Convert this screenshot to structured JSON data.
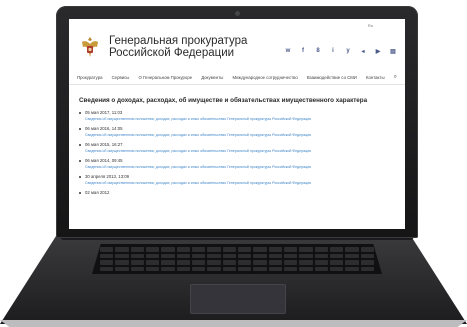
{
  "site": {
    "title_line1": "Генеральная прокуратура",
    "title_line2": "Российской Федерации",
    "topbar": [
      "Ru",
      "",
      "",
      ""
    ],
    "social": [
      "vk-icon",
      "facebook-icon",
      "odnoklassniki-icon",
      "instagram-icon",
      "twitter-icon",
      "telegram-icon",
      "youtube-icon",
      "rss-icon"
    ],
    "social_glyphs": [
      "w",
      "f",
      "8",
      "i",
      "y",
      "◂",
      "▶",
      "▤"
    ]
  },
  "nav": {
    "items": [
      "Прокуратура",
      "Cервисы",
      "О Генеральном Прокуроре",
      "Документы",
      "Международное сотрудничество",
      "Взаимодействие со СМИ",
      "Контакты"
    ],
    "search_glyph": "⌕"
  },
  "content": {
    "heading": "Сведения о доходах, расходах, об имуществе и обязательствах имущественного характера",
    "entries": [
      {
        "date": "05 мая 2017, 11:03",
        "link": "Сведения об имущественном положении, доходах, расходах и иных обязательствах Генеральной прокуратуры Российской Федерации"
      },
      {
        "date": "06 мая 2016, 14:05",
        "link": "Сведения об имущественном положении, доходах, расходах и иных обязательствах Генеральной прокуратуры Российской Федерации"
      },
      {
        "date": "06 мая 2015, 16:27",
        "link": "Сведения об имущественном положении, доходах, расходах и иных обязательствах Генеральной прокуратуры Российской Федерации"
      },
      {
        "date": "06 мая 2014, 09:45",
        "link": "Сведения об имущественном положении, доходах, расходах и иных обязательствах Генеральной прокуратуры Российской Федерации"
      },
      {
        "date": "30 апреля 2013, 13:09",
        "link": "Сведения об имущественном положении, доходах, расходах и иных обязательствах Генеральной прокуратуры Российской Федерации"
      },
      {
        "date": "02 мая 2012",
        "link": ""
      }
    ]
  }
}
